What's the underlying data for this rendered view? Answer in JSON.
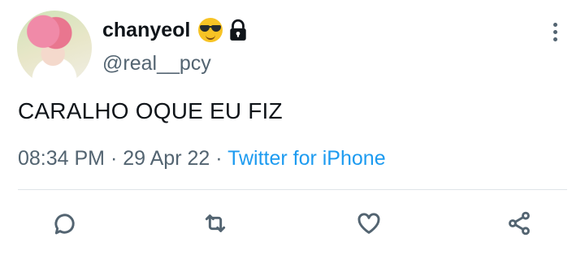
{
  "user": {
    "display_name": "chanyeol",
    "handle": "@real__pcy",
    "badges": [
      "sunglasses-emoji",
      "lock-icon"
    ]
  },
  "tweet": {
    "text": "CARALHO OQUE EU FIZ",
    "time": "08:34 PM",
    "date": "29 Apr 22",
    "source": "Twitter for iPhone",
    "separator": "·"
  },
  "actions": [
    "reply-icon",
    "retweet-icon",
    "like-icon",
    "share-icon"
  ],
  "colors": {
    "text": "#0f1419",
    "secondary": "#536471",
    "link": "#1d9bf0",
    "divider": "#dfe4e8"
  }
}
